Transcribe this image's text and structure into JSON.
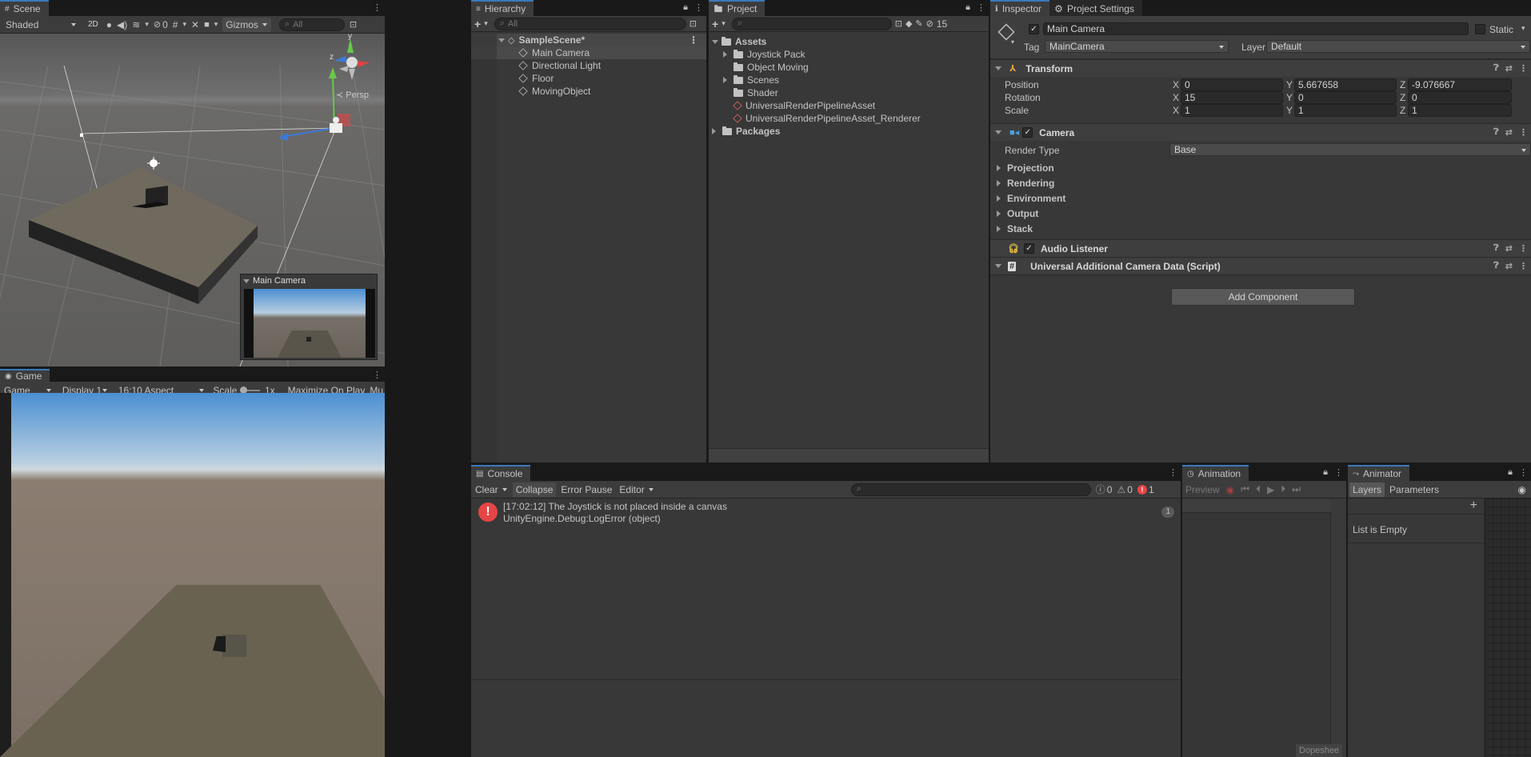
{
  "scene": {
    "tab": "Scene",
    "shading": "Shaded",
    "mode_2d": "2D",
    "hidden_count": "0",
    "gizmos": "Gizmos",
    "search_placeholder": "All",
    "persp": "Persp",
    "preview_title": "Main Camera",
    "gizmo_axis_y": "y",
    "gizmo_axis_z": "z"
  },
  "game": {
    "tab": "Game",
    "mode": "Game",
    "display": "Display 1",
    "aspect": "16:10 Aspect",
    "scale_label": "Scale",
    "scale_value": "1x",
    "maximize": "Maximize On Play",
    "more": "Mu"
  },
  "hierarchy": {
    "tab": "Hierarchy",
    "search_placeholder": "All",
    "scene_name": "SampleScene*",
    "items": [
      "Main Camera",
      "Directional Light",
      "Floor",
      "MovingObject"
    ]
  },
  "project": {
    "tab": "Project",
    "hidden_count": "15",
    "assets_label": "Assets",
    "assets": [
      {
        "name": "Joystick Pack",
        "type": "folder",
        "expandable": true
      },
      {
        "name": "Object Moving",
        "type": "folder",
        "expandable": false
      },
      {
        "name": "Scenes",
        "type": "folder",
        "expandable": true
      },
      {
        "name": "Shader",
        "type": "folder",
        "expandable": false
      },
      {
        "name": "UniversalRenderPipelineAsset",
        "type": "asset"
      },
      {
        "name": "UniversalRenderPipelineAsset_Renderer",
        "type": "asset"
      }
    ],
    "packages_label": "Packages"
  },
  "inspector": {
    "tab": "Inspector",
    "tab2": "Project Settings",
    "object_name": "Main Camera",
    "static_label": "Static",
    "tag_label": "Tag",
    "tag_value": "MainCamera",
    "layer_label": "Layer",
    "layer_value": "Default",
    "transform": {
      "title": "Transform",
      "position_label": "Position",
      "rotation_label": "Rotation",
      "scale_label": "Scale",
      "position": {
        "x": "0",
        "y": "5.667658",
        "z": "-9.076667"
      },
      "rotation": {
        "x": "15",
        "y": "0",
        "z": "0"
      },
      "scale": {
        "x": "1",
        "y": "1",
        "z": "1"
      }
    },
    "camera": {
      "title": "Camera",
      "render_type_label": "Render Type",
      "render_type_value": "Base",
      "sections": [
        "Projection",
        "Rendering",
        "Environment",
        "Output",
        "Stack"
      ]
    },
    "audio_listener": "Audio Listener",
    "urp_data": "Universal Additional Camera Data (Script)",
    "add_component": "Add Component"
  },
  "console": {
    "tab": "Console",
    "clear": "Clear",
    "collapse": "Collapse",
    "error_pause": "Error Pause",
    "editor": "Editor",
    "log_count": "0",
    "warn_count": "0",
    "error_count": "1",
    "entry_line1": "[17:02:12] The Joystick is not placed inside a canvas",
    "entry_line2": "UnityEngine.Debug:LogError (object)",
    "entry_count": "1"
  },
  "animation": {
    "tab": "Animation",
    "preview": "Preview",
    "dopesheet": "Dopeshee"
  },
  "animator": {
    "tab": "Animator",
    "layers": "Layers",
    "parameters": "Parameters",
    "empty": "List is Empty"
  },
  "colors": {
    "accent": "#3a79bb",
    "error": "#e64545",
    "sky_top": "#6a96c8",
    "ground": "#7a6c60"
  }
}
